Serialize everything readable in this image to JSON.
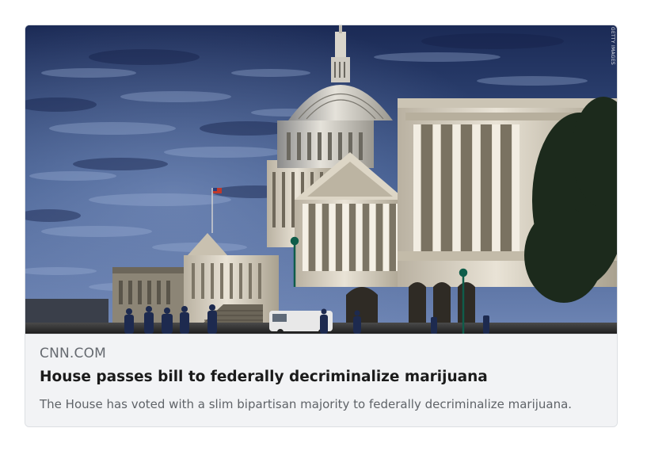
{
  "link_preview": {
    "domain": "CNN.COM",
    "title": "House passes bill to federally decriminalize marijuana",
    "description": "The House has voted with a slim bipartisan majority to federally decriminalize marijuana.",
    "image": {
      "credit": "GETTY IMAGES",
      "subject": "U.S. Capitol building under cloudy sky"
    }
  },
  "colors": {
    "sky": "#2c3f6e",
    "building": "#d9d2c3",
    "meta_background": "#f2f3f5",
    "title_text": "#1b1b1b",
    "domain_text": "#666a70"
  }
}
